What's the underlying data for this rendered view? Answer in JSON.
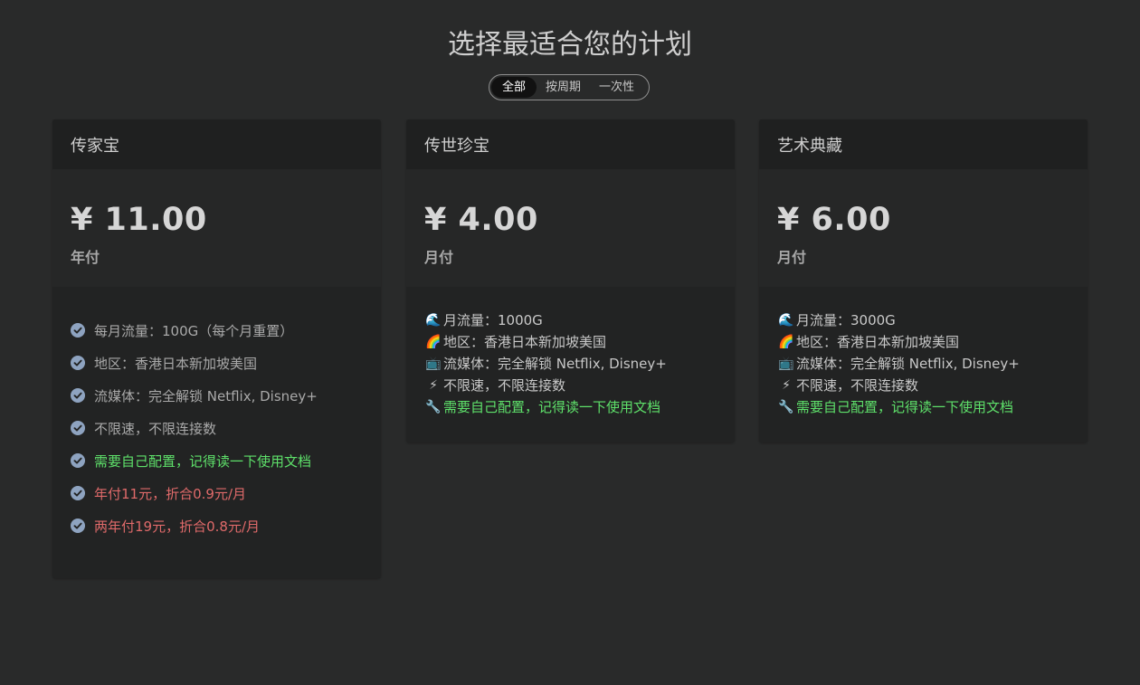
{
  "page_title": "选择最适合您的计划",
  "tabs": [
    {
      "label": "全部",
      "active": true
    },
    {
      "label": "按周期",
      "active": false
    },
    {
      "label": "一次性",
      "active": false
    }
  ],
  "plans": [
    {
      "name": "传家宝",
      "price": "¥ 11.00",
      "period": "年付",
      "features": [
        {
          "text": "每月流量：100G（每个月重置）",
          "color": "default"
        },
        {
          "text": "地区：香港日本新加坡美国",
          "color": "default"
        },
        {
          "text": "流媒体：完全解锁 Netflix, Disney+",
          "color": "default"
        },
        {
          "text": "不限速，不限连接数",
          "color": "default"
        },
        {
          "text": "需要自己配置，记得读一下使用文档",
          "color": "green"
        },
        {
          "text": "年付11元，折合0.9元/月",
          "color": "red"
        },
        {
          "text": "两年付19元，折合0.8元/月",
          "color": "red"
        }
      ]
    },
    {
      "name": "传世珍宝",
      "price": "¥ 4.00",
      "period": "月付",
      "features": [
        {
          "icon": "wave-icon",
          "glyph": "🌊",
          "text": "月流量：1000G",
          "color": "default"
        },
        {
          "icon": "rainbow-icon",
          "glyph": "🌈",
          "text": "地区：香港日本新加坡美国",
          "color": "default"
        },
        {
          "icon": "tv-icon",
          "glyph": "📺",
          "text": "流媒体：完全解锁 Netflix, Disney+",
          "color": "default"
        },
        {
          "icon": "lightning-icon",
          "glyph": "⚡",
          "text": "不限速，不限连接数",
          "color": "default"
        },
        {
          "icon": "wrench-icon",
          "glyph": "🔧",
          "text": "需要自己配置，记得读一下使用文档",
          "color": "green"
        }
      ]
    },
    {
      "name": "艺术典藏",
      "price": "¥ 6.00",
      "period": "月付",
      "features": [
        {
          "icon": "wave-icon",
          "glyph": "🌊",
          "text": "月流量：3000G",
          "color": "default"
        },
        {
          "icon": "rainbow-icon",
          "glyph": "🌈",
          "text": "地区：香港日本新加坡美国",
          "color": "default"
        },
        {
          "icon": "tv-icon",
          "glyph": "📺",
          "text": "流媒体：完全解锁 Netflix, Disney+",
          "color": "default"
        },
        {
          "icon": "lightning-icon",
          "glyph": "⚡",
          "text": "不限速，不限连接数",
          "color": "default"
        },
        {
          "icon": "wrench-icon",
          "glyph": "🔧",
          "text": "需要自己配置，记得读一下使用文档",
          "color": "green"
        }
      ]
    }
  ],
  "colors": {
    "background": "#292a2a",
    "card": "#222323",
    "accent_green": "#5ee06a",
    "accent_red": "#e06a6a",
    "check_icon": "#8ea3c0"
  }
}
